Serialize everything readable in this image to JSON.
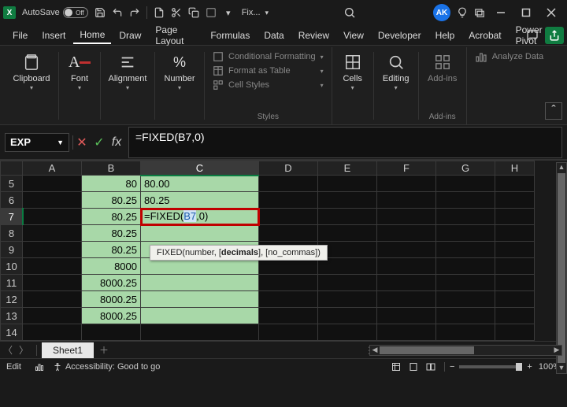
{
  "titlebar": {
    "autosave_label": "AutoSave",
    "autosave_state": "Off",
    "filename": "Fix...",
    "avatar_initials": "AK"
  },
  "menubar": {
    "items": [
      "File",
      "Insert",
      "Home",
      "Draw",
      "Page Layout",
      "Formulas",
      "Data",
      "Review",
      "View",
      "Developer",
      "Help",
      "Acrobat",
      "Power Pivot"
    ],
    "active_index": 2
  },
  "ribbon": {
    "clipboard": "Clipboard",
    "font": "Font",
    "alignment": "Alignment",
    "number": "Number",
    "styles_group": "Styles",
    "cond_fmt": "Conditional Formatting",
    "fmt_table": "Format as Table",
    "cell_styles": "Cell Styles",
    "cells": "Cells",
    "editing": "Editing",
    "addins": "Add-ins",
    "addins_group": "Add-ins",
    "analyze": "Analyze Data"
  },
  "formula_bar": {
    "name_box": "EXP",
    "fx_label": "fx",
    "formula_text": "=FIXED(B7,0)"
  },
  "grid": {
    "columns": [
      "A",
      "B",
      "C",
      "D",
      "E",
      "F",
      "G",
      "H"
    ],
    "rows_shown": [
      5,
      6,
      7,
      8,
      9,
      10,
      11,
      12,
      13,
      14
    ],
    "active_row": 7,
    "active_col": "C",
    "data_B": {
      "5": "80",
      "6": "80.25",
      "7": "80.25",
      "8": "80.25",
      "9": "80.25",
      "10": "8000",
      "11": "8000.25",
      "12": "8000.25",
      "13": "8000.25"
    },
    "data_C": {
      "5": "80.00",
      "6": "80.25"
    },
    "editing_cell": {
      "prefix": "=FIXED(",
      "ref": "B7",
      "suffix": ",0)"
    },
    "tooltip_plain1": "FIXED(number, [",
    "tooltip_bold": "decimals",
    "tooltip_plain2": "], [no_commas])"
  },
  "sheet_tabs": {
    "active": "Sheet1"
  },
  "status_bar": {
    "mode": "Edit",
    "accessibility": "Accessibility: Good to go",
    "zoom": "100%"
  }
}
